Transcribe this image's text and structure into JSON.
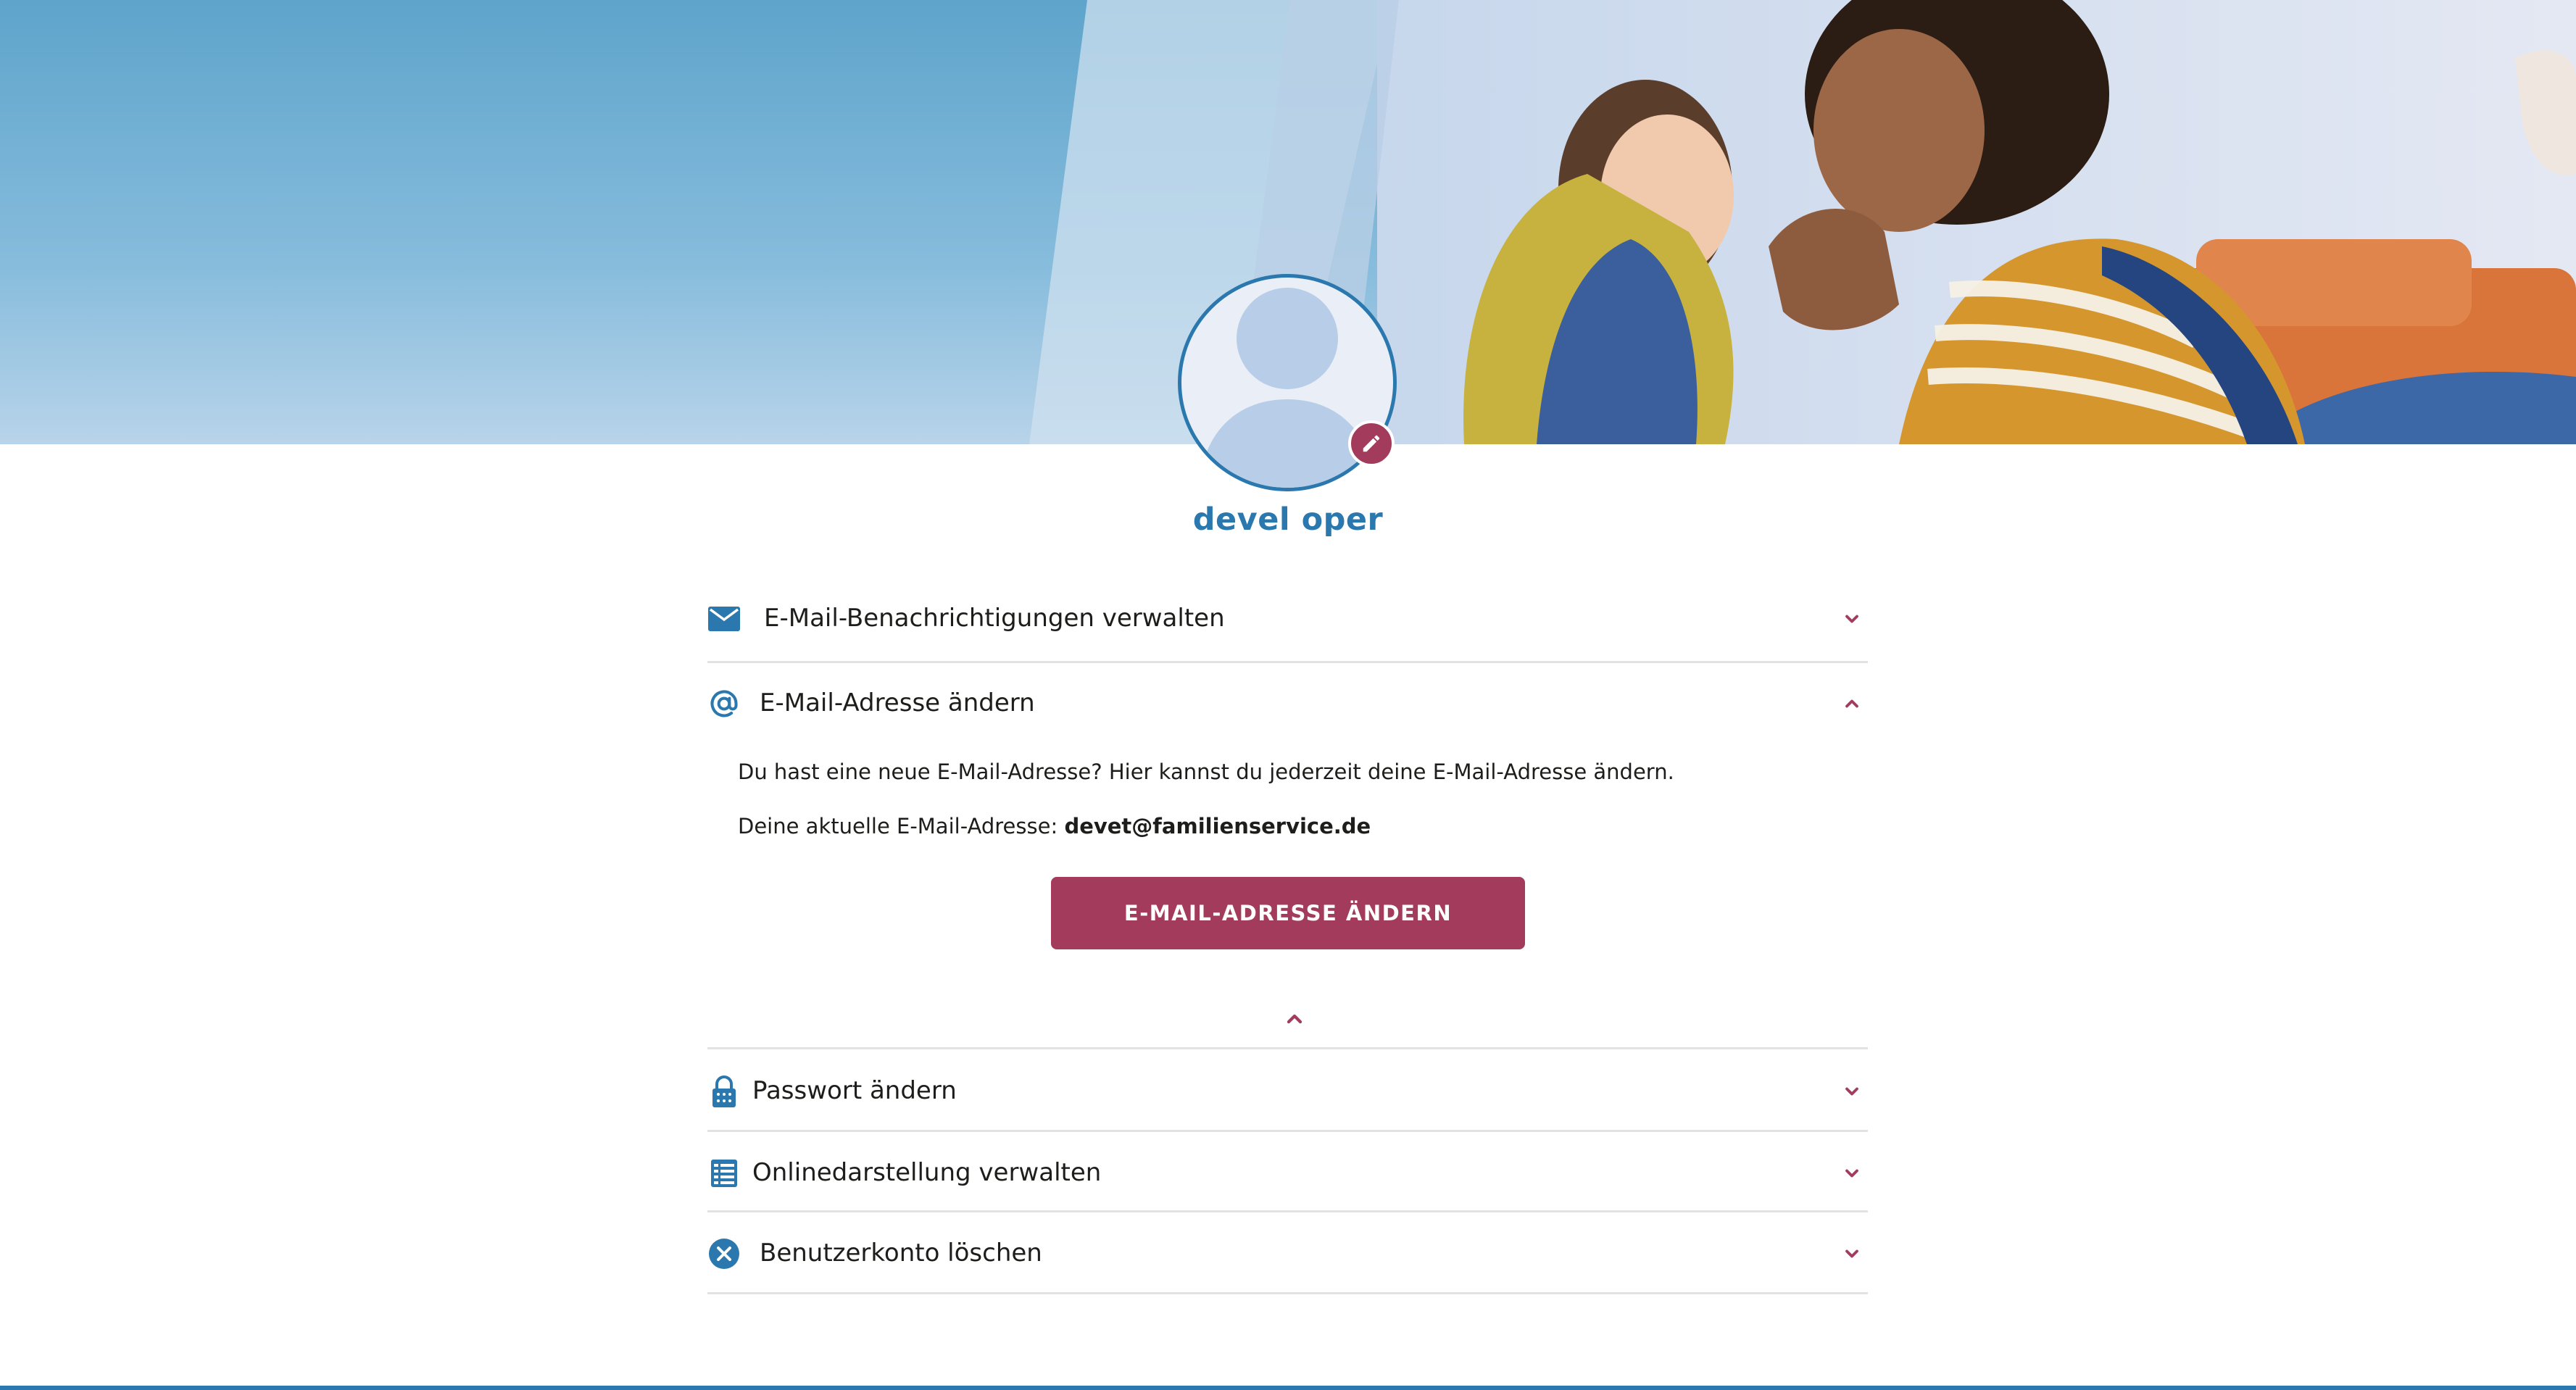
{
  "profile": {
    "username": "devel oper"
  },
  "sections": {
    "notifications": {
      "label": "E-Mail-Benachrichtigungen verwalten"
    },
    "email": {
      "label": "E-Mail-Adresse ändern",
      "description": "Du hast eine neue E-Mail-Adresse? Hier kannst du jederzeit deine E-Mail-Adresse ändern.",
      "current_label": "Deine aktuelle E-Mail-Adresse: ",
      "current_value": "devet@familienservice.de",
      "button_label": "E-Mail-Adresse ändern"
    },
    "password": {
      "label": "Passwort ändern"
    },
    "online": {
      "label": "Onlinedarstellung verwalten"
    },
    "delete": {
      "label": "Benutzerkonto löschen"
    }
  },
  "icons": {
    "notifications": "envelope-icon",
    "email": "at-sign-icon",
    "password": "lock-icon",
    "online": "list-icon",
    "delete": "close-circle-icon",
    "avatar_edit": "pencil-icon",
    "expand": "chevron-down-icon",
    "collapse": "chevron-up-icon"
  },
  "colors": {
    "primary_blue": "#2a78ad",
    "accent_berry": "#a23b5c",
    "divider": "#e2e2e2"
  }
}
